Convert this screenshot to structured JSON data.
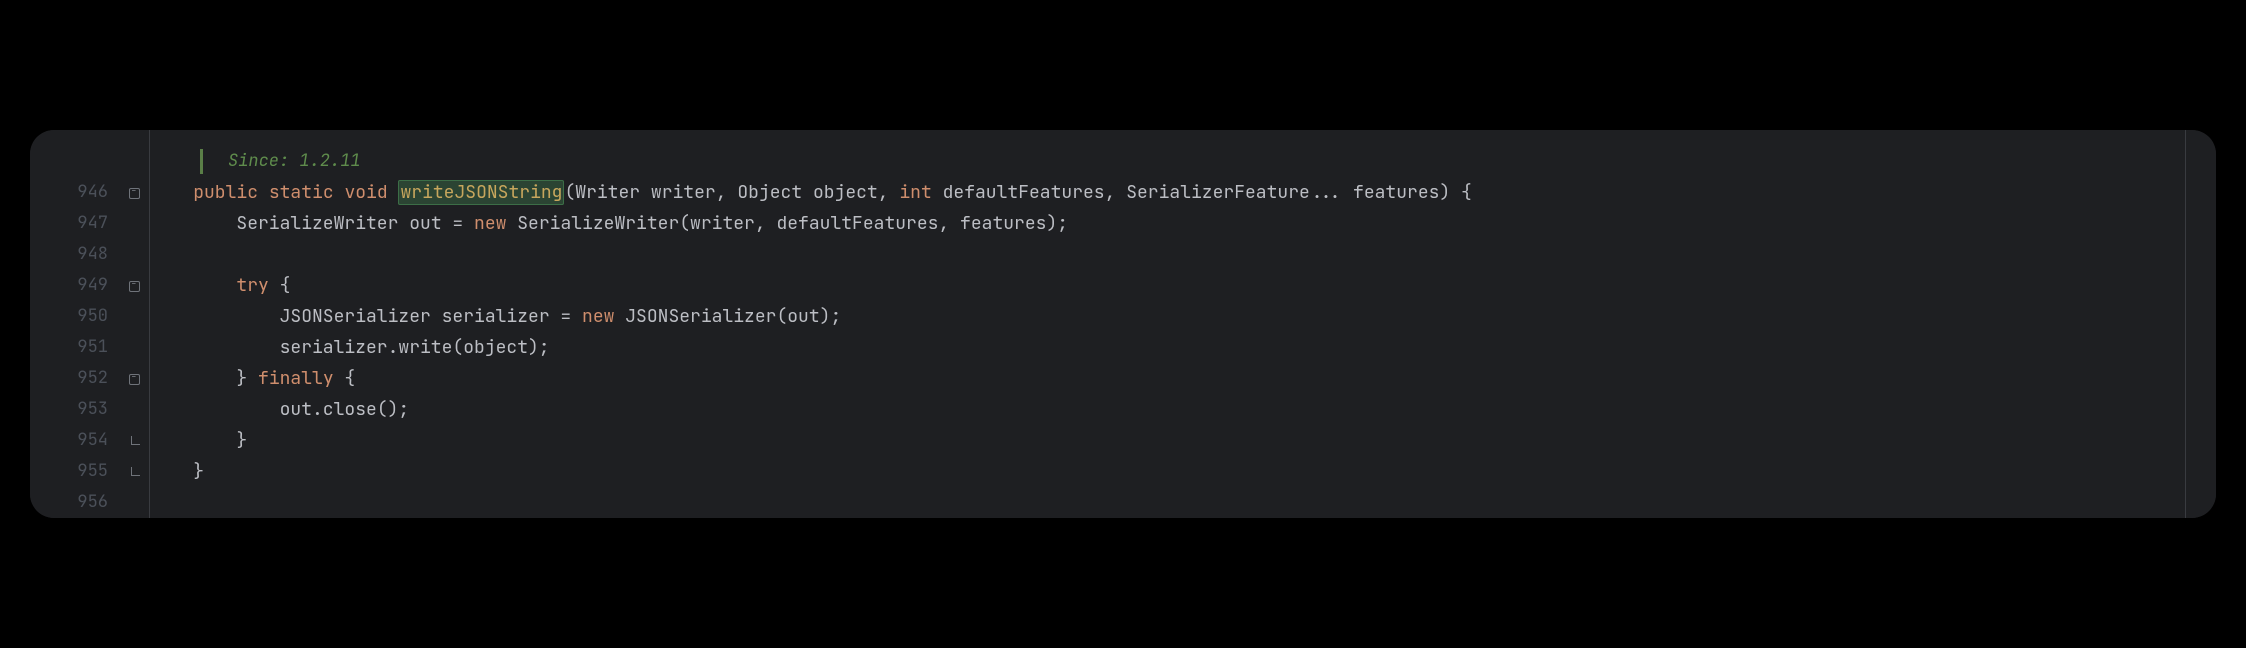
{
  "annotation": "Since: 1.2.11",
  "gutter": {
    "line_numbers": [
      "946",
      "947",
      "948",
      "949",
      "950",
      "951",
      "952",
      "953",
      "954",
      "955",
      "956"
    ]
  },
  "folds": {
    "line946": "minus",
    "line949": "minus",
    "line952": "minus",
    "line954": "end",
    "line955": "end"
  },
  "code": {
    "line946": {
      "k_public": "public",
      "k_static": "static",
      "k_void": "void",
      "method": "writeJSONString",
      "p_open": "(",
      "type1": "Writer",
      "param1": "writer",
      "comma1": ", ",
      "type2": "Object",
      "param2": "object",
      "comma2": ", ",
      "k_int": "int",
      "param3": "defaultFeatures",
      "comma3": ", ",
      "type4": "SerializerFeature",
      "varargs": "...",
      "param4": "features",
      "p_close": ")",
      "brace": " {"
    },
    "line947": {
      "type": "SerializeWriter",
      "var": "out",
      "eq": " = ",
      "k_new": "new",
      "ctor": "SerializeWriter",
      "args": "(writer, defaultFeatures, features);"
    },
    "line949": {
      "k_try": "try",
      "brace": " {"
    },
    "line950": {
      "type": "JSONSerializer",
      "var": "serializer",
      "eq": " = ",
      "k_new": "new",
      "ctor": "JSONSerializer",
      "args": "(out);"
    },
    "line951": {
      "text": "serializer.write(object);"
    },
    "line952": {
      "close": "}",
      "k_finally": " finally ",
      "brace": "{"
    },
    "line953": {
      "text": "out.close();"
    },
    "line954": {
      "close": "}"
    },
    "line955": {
      "close": "}"
    }
  }
}
